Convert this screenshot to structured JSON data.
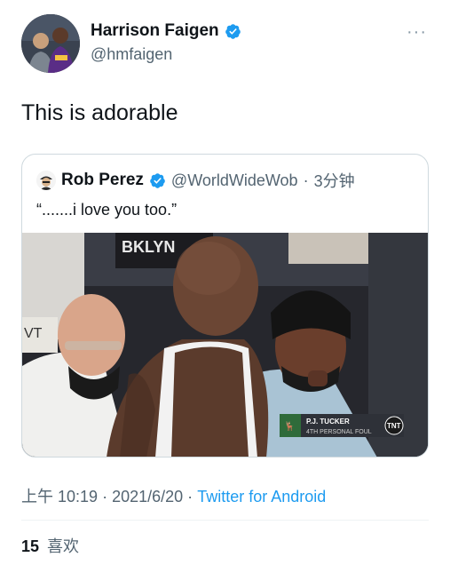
{
  "author": {
    "display_name": "Harrison Faigen",
    "handle": "@hmfaigen",
    "avatar": "avatar-photo",
    "verified_icon": "verified-badge-icon",
    "more_label": "···"
  },
  "tweet": {
    "text": "This is adorable"
  },
  "quoted_tweet": {
    "display_name": "Rob Perez",
    "handle": "@WorldWideWob",
    "separator": "·",
    "time": "3分钟",
    "text": "“.......i love you too.”",
    "media_overlay": {
      "player_name": "P.J. TUCKER",
      "foul_text": "4TH PERSONAL FOUL",
      "network": "TNT"
    },
    "jersey_text": "BKLYN"
  },
  "meta": {
    "time": "上午 10:19",
    "separator1": "·",
    "date": "2021/6/20",
    "separator2": "·",
    "source": "Twitter for Android"
  },
  "engagement": {
    "likes_count": "15",
    "likes_label": "喜欢"
  },
  "colors": {
    "link": "#1d9bf0",
    "secondary_text": "#536471",
    "verified": "#1d9bf0"
  }
}
